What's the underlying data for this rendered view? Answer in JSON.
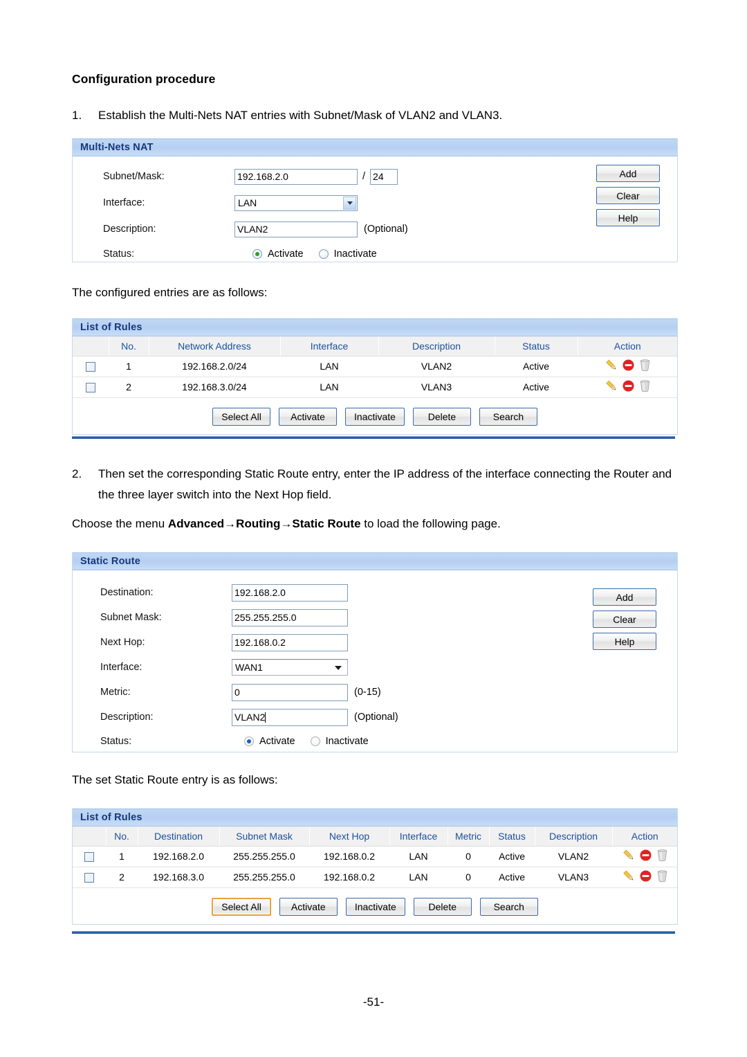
{
  "document": {
    "heading": "Configuration procedure",
    "step1_num": "1.",
    "step1_text": "Establish the Multi-Nets NAT entries with Subnet/Mask of VLAN2 and VLAN3.",
    "after_step1": "The configured entries are as follows:",
    "step2_num": "2.",
    "step2_text": "Then set the corresponding Static Route entry, enter the IP address of the interface connecting the Router and the three layer switch into the Next Hop field.",
    "menu_prefix": "Choose the menu ",
    "menu_path_1": "Advanced",
    "menu_arrow_1": "→",
    "menu_path_2": "Routing",
    "menu_arrow_2": "→",
    "menu_path_3": "Static Route",
    "menu_suffix": " to load the following page.",
    "after_static": "The set Static Route entry is as follows:",
    "page_number": "-51-"
  },
  "nat_panel": {
    "title": "Multi-Nets NAT",
    "fields": {
      "subnet_label": "Subnet/Mask:",
      "subnet_value": "192.168.2.0",
      "slash": "/",
      "mask_value": "24",
      "interface_label": "Interface:",
      "interface_value": "LAN",
      "description_label": "Description:",
      "description_value": "VLAN2",
      "description_hint": "(Optional)",
      "status_label": "Status:",
      "status_activate": "Activate",
      "status_inactivate": "Inactivate",
      "status_selected": "Activate"
    },
    "buttons": [
      "Add",
      "Clear",
      "Help"
    ]
  },
  "nat_list": {
    "title": "List of Rules",
    "columns": [
      "",
      "No.",
      "Network Address",
      "Interface",
      "Description",
      "Status",
      "Action"
    ],
    "rows": [
      {
        "no": "1",
        "network": "192.168.2.0/24",
        "interface": "LAN",
        "description": "VLAN2",
        "status": "Active"
      },
      {
        "no": "2",
        "network": "192.168.3.0/24",
        "interface": "LAN",
        "description": "VLAN3",
        "status": "Active"
      }
    ],
    "buttons": [
      "Select All",
      "Activate",
      "Inactivate",
      "Delete",
      "Search"
    ],
    "focused_button": ""
  },
  "static_route_panel": {
    "title": "Static Route",
    "fields": {
      "destination_label": "Destination:",
      "destination_value": "192.168.2.0",
      "subnet_mask_label": "Subnet Mask:",
      "subnet_mask_value": "255.255.255.0",
      "next_hop_label": "Next Hop:",
      "next_hop_value": "192.168.0.2",
      "interface_label": "Interface:",
      "interface_value": "WAN1",
      "metric_label": "Metric:",
      "metric_value": "0",
      "metric_hint": "(0-15)",
      "description_label": "Description:",
      "description_value": "VLAN2",
      "description_hint": "(Optional)",
      "status_label": "Status:",
      "status_activate": "Activate",
      "status_inactivate": "Inactivate",
      "status_selected": "Activate"
    },
    "buttons": [
      "Add",
      "Clear",
      "Help"
    ]
  },
  "route_list": {
    "title": "List of Rules",
    "columns": [
      "",
      "No.",
      "Destination",
      "Subnet Mask",
      "Next Hop",
      "Interface",
      "Metric",
      "Status",
      "Description",
      "Action"
    ],
    "rows": [
      {
        "no": "1",
        "destination": "192.168.2.0",
        "mask": "255.255.255.0",
        "next_hop": "192.168.0.2",
        "interface": "LAN",
        "metric": "0",
        "status": "Active",
        "description": "VLAN2"
      },
      {
        "no": "2",
        "destination": "192.168.3.0",
        "mask": "255.255.255.0",
        "next_hop": "192.168.0.2",
        "interface": "LAN",
        "metric": "0",
        "status": "Active",
        "description": "VLAN3"
      }
    ],
    "buttons": [
      "Select All",
      "Activate",
      "Inactivate",
      "Delete",
      "Search"
    ],
    "focused_button": "Select All"
  },
  "colors": {
    "panel_header_bg": "#b9d2f2",
    "panel_header_text": "#16387a",
    "table_header_text": "#1b4f9c",
    "rule_line": "#2a5fa5",
    "button_border": "#3a69a8",
    "focus_border": "#e8a13a",
    "radio_green": "#2aa02a",
    "radio_blue": "#1a5fc0",
    "icon_edit": "#f0b429",
    "icon_disable": "#e02020",
    "icon_delete": "#b9b9b9"
  },
  "icons": {
    "edit": "pencil-icon",
    "disable": "no-entry-icon",
    "delete": "trash-icon"
  }
}
